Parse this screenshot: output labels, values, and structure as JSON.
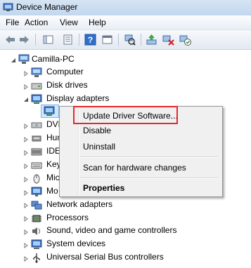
{
  "window": {
    "title": "Device Manager"
  },
  "menu": {
    "items": [
      "File",
      "Action",
      "View",
      "Help"
    ]
  },
  "toolbar": {
    "icons": [
      "back-arrow-icon",
      "forward-arrow-icon",
      "tree-view-icon",
      "properties-icon",
      "help-icon",
      "console-icon",
      "scan-hardware-icon",
      "update-driver-icon",
      "uninstall-icon",
      "enable-device-icon"
    ]
  },
  "tree": {
    "root": "Camilla-PC",
    "items": {
      "computer": "Computer",
      "disk_drives": "Disk drives",
      "display_adapters": "Display adapters",
      "dvd": "DVD",
      "human": "Hum",
      "ide": "IDE",
      "keyboards": "Key",
      "mice": "Mic",
      "monitors": "Mo",
      "network": "Network adapters",
      "processors": "Processors",
      "sound": "Sound, video and game controllers",
      "system": "System devices",
      "usb": "Universal Serial Bus controllers"
    }
  },
  "context_menu": {
    "update": "Update Driver Software...",
    "disable": "Disable",
    "uninstall": "Uninstall",
    "scan": "Scan for hardware changes",
    "properties": "Properties"
  },
  "colors": {
    "highlight": "#e8282c",
    "titlebar": "#c2d7ee"
  }
}
